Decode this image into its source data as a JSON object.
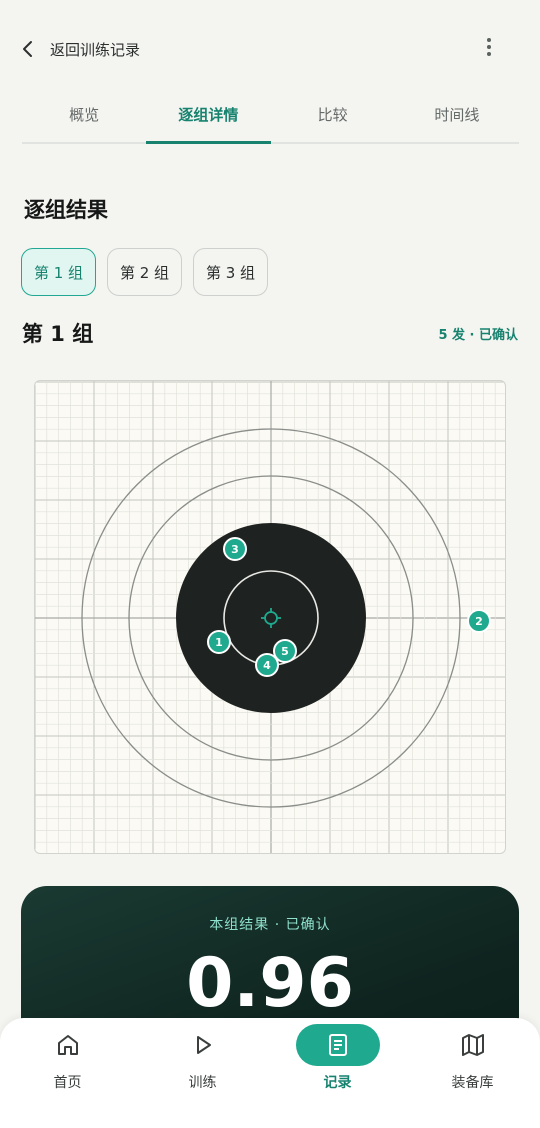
{
  "header": {
    "back_label": "返回训练记录",
    "back_icon": "chevron-left-icon",
    "more_icon": "more-vertical-icon"
  },
  "tabs": [
    {
      "label": "概览",
      "active": false
    },
    {
      "label": "逐组详情",
      "active": true
    },
    {
      "label": "比较",
      "active": false
    },
    {
      "label": "时间线",
      "active": false
    }
  ],
  "section_title": "逐组结果",
  "groups": [
    {
      "label": "第 1 组",
      "selected": true
    },
    {
      "label": "第 2 组",
      "selected": false
    },
    {
      "label": "第 3 组",
      "selected": false
    }
  ],
  "current_group": {
    "title": "第 1 组",
    "status": "5 发 · 已确认",
    "shots": [
      {
        "label": "1"
      },
      {
        "label": "2"
      },
      {
        "label": "3"
      },
      {
        "label": "4"
      },
      {
        "label": "5"
      }
    ]
  },
  "result": {
    "label": "本组结果 · 已确认",
    "score": "0.96"
  },
  "bottom_nav": [
    {
      "label": "首页",
      "icon": "home-icon",
      "active": false
    },
    {
      "label": "训练",
      "icon": "play-icon",
      "active": false
    },
    {
      "label": "记录",
      "icon": "document-icon",
      "active": true
    },
    {
      "label": "装备库",
      "icon": "map-icon",
      "active": false
    }
  ],
  "colors": {
    "accent": "#17836f",
    "shot_marker": "#1fa98f",
    "bullseye": "#1e2220",
    "result_card": "#0f241f"
  }
}
